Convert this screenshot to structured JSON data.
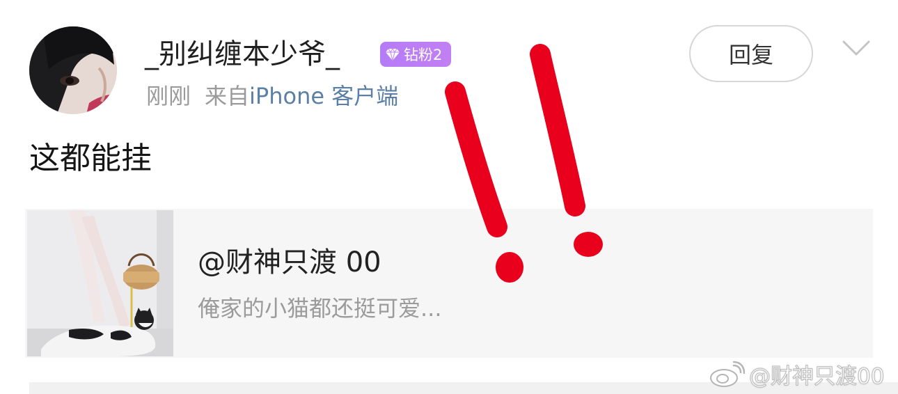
{
  "comment": {
    "username": "_别纠缠本少爷_",
    "badge_label": "钻粉2",
    "time": "刚刚",
    "source_prefix": "来自",
    "source_client": "iPhone 客户端",
    "reply_label": "回复",
    "text": "这都能挂"
  },
  "share_card": {
    "title": "@财神只渡 00",
    "snippet": "俺家的小猫都还挺可爱..."
  },
  "watermark": {
    "text": "@财神只渡00"
  },
  "colors": {
    "badge": "#b57cf7",
    "source_link": "#5b7fa6",
    "annotation": "#e8001c"
  },
  "icons": [
    "avatar",
    "diamond-gem-icon",
    "chevron-down-icon",
    "weibo-logo-icon"
  ]
}
